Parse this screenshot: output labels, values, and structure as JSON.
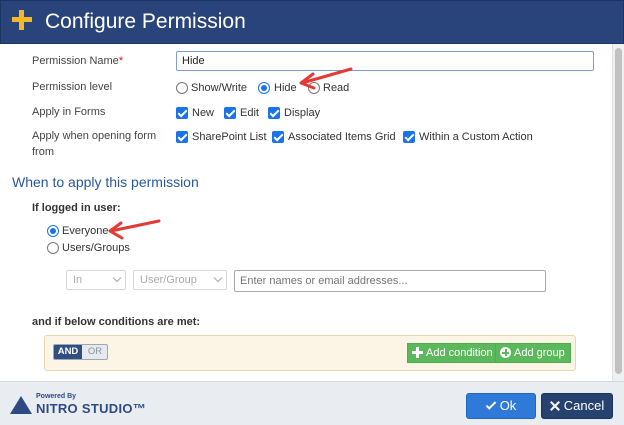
{
  "dialog": {
    "title": "Configure Permission"
  },
  "form": {
    "permission_name_label": "Permission Name",
    "required_mark": "*",
    "permission_name_value": "Hide",
    "permission_level_label": "Permission level",
    "permission_level_options": [
      "Show/Write",
      "Hide",
      "Read"
    ],
    "permission_level_selected": "Hide",
    "apply_in_forms_label": "Apply in Forms",
    "apply_in_forms_options": [
      "New",
      "Edit",
      "Display"
    ],
    "apply_opening_label_1": "Apply when opening form",
    "apply_opening_label_2": "from",
    "apply_opening_options": [
      "SharePoint List",
      "Associated Items Grid",
      "Within a Custom Action"
    ]
  },
  "when": {
    "section_title": "When to apply this permission",
    "logged_in_label": "If logged in user:",
    "user_options": [
      "Everyone",
      "Users/Groups"
    ],
    "user_selected": "Everyone",
    "operator_select": "In",
    "type_select": "User/Group",
    "people_placeholder": "Enter names or email addresses...",
    "conditions_label": "and if below conditions are met:",
    "toggle_and": "AND",
    "toggle_or": "OR",
    "add_condition": "Add condition",
    "add_group": "Add group"
  },
  "footer": {
    "powered_by": "Powered By",
    "brand": "NITRO STUDIO™",
    "ok": "Ok",
    "cancel": "Cancel"
  },
  "colors": {
    "title_bar": "#29447a",
    "accent_plus": "#f5b829",
    "section_title": "#2b5797",
    "annotation_arrow": "#e53935",
    "ok_button": "#2f7ad9",
    "cancel_button": "#26426f",
    "green_button": "#5cb85c"
  }
}
